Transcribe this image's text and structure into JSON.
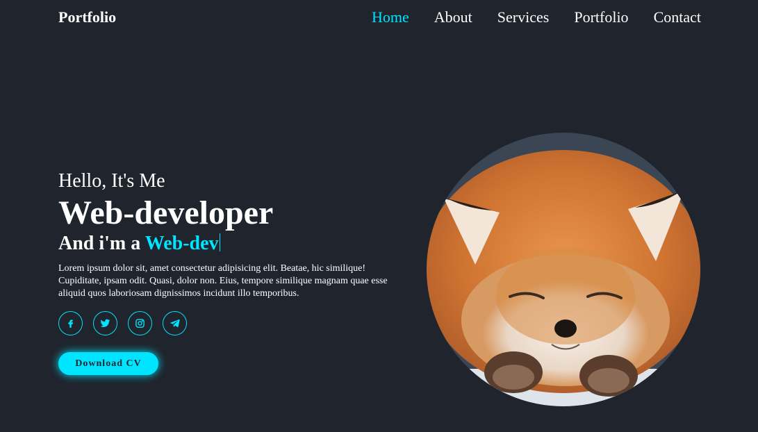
{
  "header": {
    "logo": "Portfolio",
    "nav": [
      {
        "label": "Home",
        "active": true
      },
      {
        "label": "About",
        "active": false
      },
      {
        "label": "Services",
        "active": false
      },
      {
        "label": "Portfolio",
        "active": false
      },
      {
        "label": "Contact",
        "active": false
      }
    ]
  },
  "hero": {
    "greeting": "Hello, It's Me",
    "role": "Web-developer",
    "sub_prefix": "And i'm a",
    "sub_typed": "Web-dev",
    "description": "Lorem ipsum dolor sit, amet consectetur adipisicing elit. Beatae, hic similique! Cupiditate, ipsam odit. Quasi, dolor non. Eius, tempore similique magnam quae esse aliquid quos laboriosam dignissimos incidunt illo temporibus.",
    "social": [
      "facebook-icon",
      "twitter-icon",
      "instagram-icon",
      "telegram-icon"
    ],
    "cta_label": "Download CV",
    "image_subject": "fox"
  },
  "colors": {
    "background": "#1f242d",
    "accent": "#00e5ff",
    "text": "#ffffff"
  }
}
